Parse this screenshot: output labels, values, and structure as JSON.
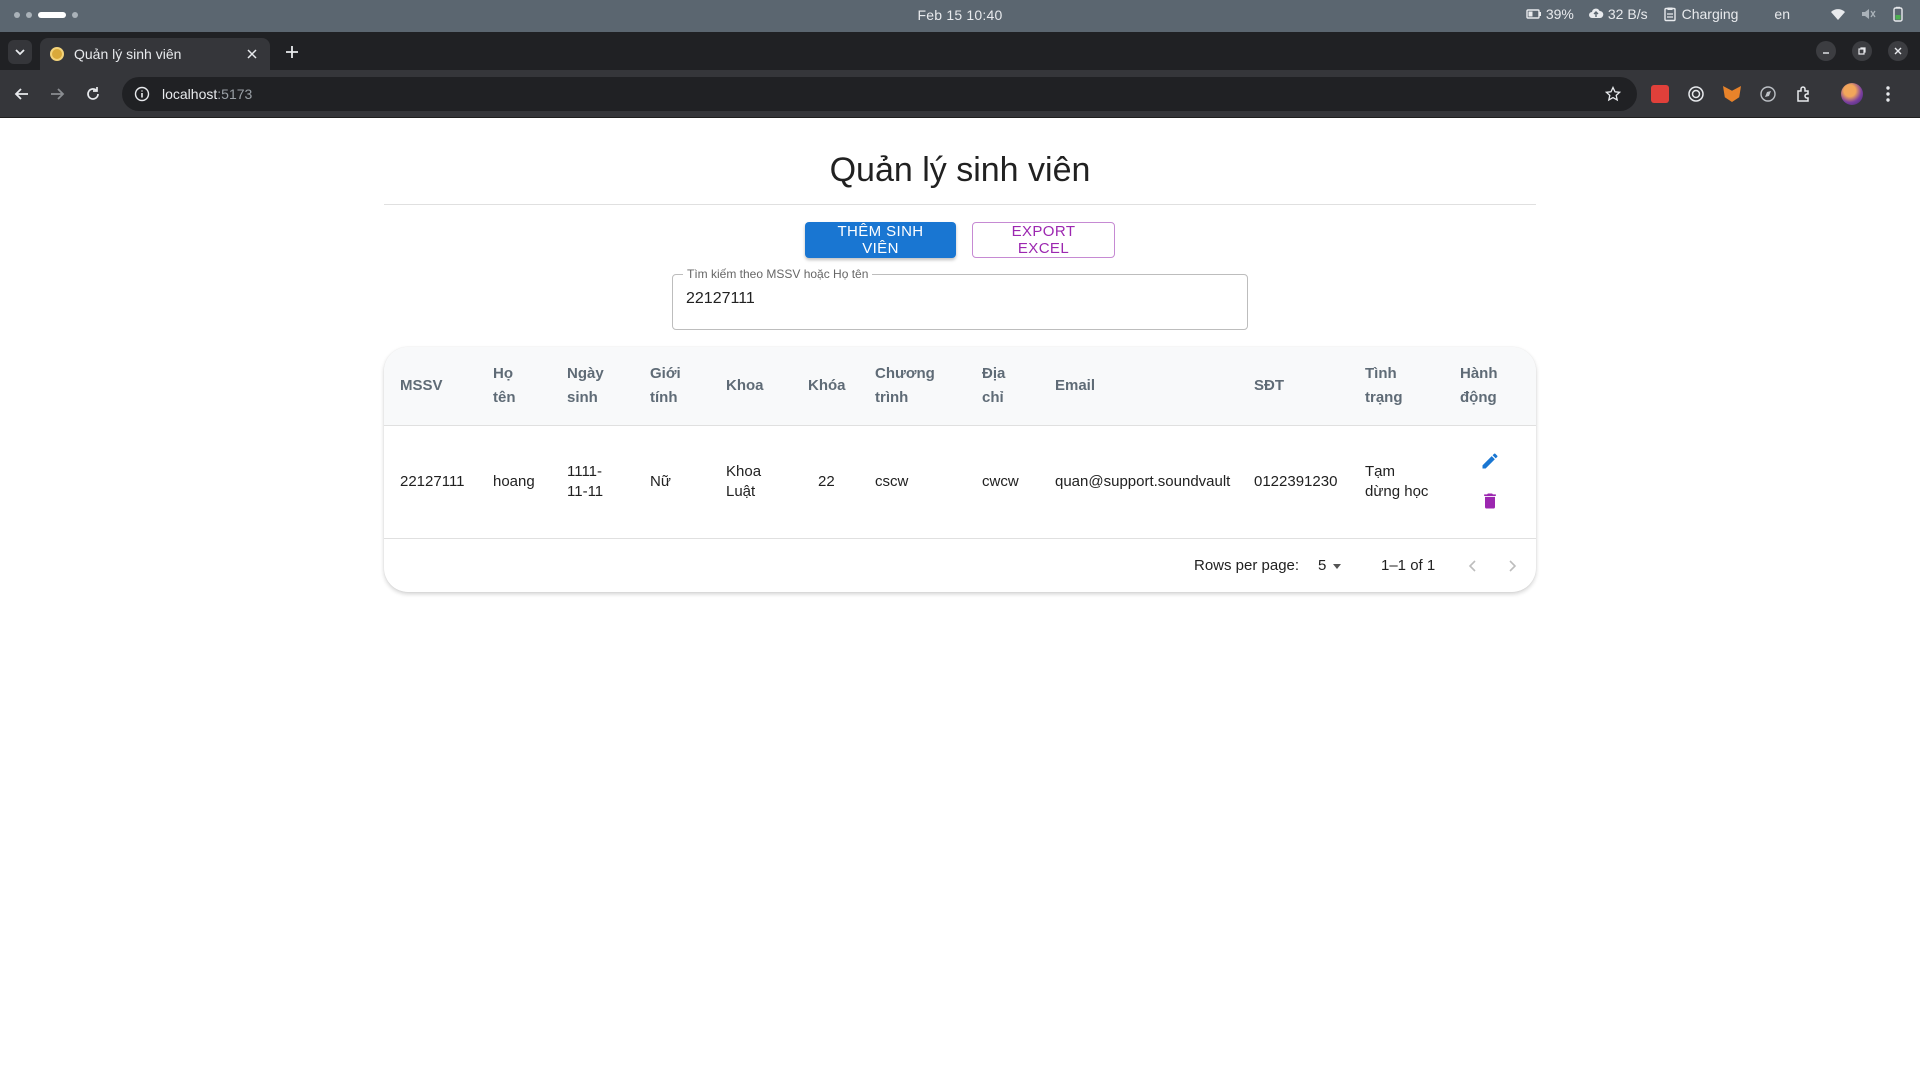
{
  "os": {
    "clock": "Feb 15  10:40",
    "battery_pct": "39%",
    "net_speed": "32 B/s",
    "charging": "Charging",
    "lang": "en"
  },
  "browser": {
    "tab_title": "Quản lý sinh viên",
    "url_host": "localhost",
    "url_port": ":5173"
  },
  "page": {
    "title": "Quản lý sinh viên",
    "add_button": "THÊM SINH VIÊN",
    "export_button": "EXPORT EXCEL",
    "search": {
      "label": "Tìm kiếm theo MSSV hoặc Họ tên",
      "value": "22127111"
    }
  },
  "table": {
    "headers": {
      "mssv": "MSSV",
      "ho_ten": [
        "Họ",
        "tên"
      ],
      "ngay_sinh": [
        "Ngày",
        "sinh"
      ],
      "gioi_tinh": [
        "Giới",
        "tính"
      ],
      "khoa": "Khoa",
      "khoa_hoc": "Khóa",
      "chuong_trinh": [
        "Chương",
        "trình"
      ],
      "dia_chi": [
        "Địa",
        "chỉ"
      ],
      "email": "Email",
      "sdt": "SĐT",
      "tinh_trang": [
        "Tình",
        "trạng"
      ],
      "hanh_dong": [
        "Hành",
        "động"
      ]
    },
    "rows": [
      {
        "mssv": "22127111",
        "ho_ten": "hoang",
        "ngay_sinh": [
          "1111-",
          "11-11"
        ],
        "gioi_tinh": "Nữ",
        "khoa": [
          "Khoa",
          "Luật"
        ],
        "khoa_hoc": "22",
        "chuong_trinh": "cscw",
        "dia_chi": "cwcw",
        "email": "quan@support.soundvault",
        "sdt": "0122391230",
        "tinh_trang": [
          "Tạm",
          "dừng học"
        ]
      }
    ],
    "pagination": {
      "rows_per_page_label": "Rows per page:",
      "rows_per_page": "5",
      "range": "1–1 of 1"
    }
  },
  "colors": {
    "primary": "#1976d2",
    "secondary": "#9c27b0"
  }
}
